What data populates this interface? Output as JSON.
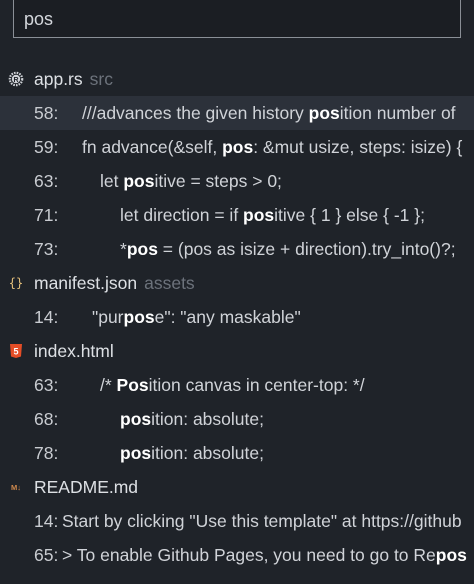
{
  "search": {
    "value": "pos"
  },
  "results": [
    {
      "kind": "file",
      "name": "app.rs",
      "dir": "src",
      "icon": "rust-icon"
    },
    {
      "kind": "line",
      "line": "58:",
      "pre": "///advances the given history ",
      "match": "pos",
      "post": "ition number of",
      "indent": 82,
      "selected": true
    },
    {
      "kind": "line",
      "line": "59:",
      "pre": "fn advance(&self, ",
      "match": "pos",
      "post": ": &mut usize, steps: isize) {",
      "indent": 82
    },
    {
      "kind": "line",
      "line": "63:",
      "pre": "let ",
      "match": "pos",
      "post": "itive = steps > 0;",
      "indent": 100
    },
    {
      "kind": "line",
      "line": "71:",
      "pre": "let direction = if ",
      "match": "pos",
      "post": "itive { 1 } else { -1 };",
      "indent": 120
    },
    {
      "kind": "line",
      "line": "73:",
      "pre": "*",
      "match": "pos",
      "post": " = (pos as isize + direction).try_into()?;",
      "indent": 120
    },
    {
      "kind": "file",
      "name": "manifest.json",
      "dir": "assets",
      "icon": "json-icon"
    },
    {
      "kind": "line",
      "line": "14:",
      "pre": "\"pur",
      "match": "pos",
      "post": "e\": \"any maskable\"",
      "indent": 92
    },
    {
      "kind": "file",
      "name": "index.html",
      "dir": "",
      "icon": "html5-icon"
    },
    {
      "kind": "line",
      "line": "63:",
      "pre": "/* ",
      "match": "Pos",
      "post": "ition canvas in center-top: */",
      "indent": 100
    },
    {
      "kind": "line",
      "line": "68:",
      "pre": "",
      "match": "pos",
      "post": "ition: absolute;",
      "indent": 120
    },
    {
      "kind": "line",
      "line": "78:",
      "pre": "",
      "match": "pos",
      "post": "ition: absolute;",
      "indent": 120
    },
    {
      "kind": "file",
      "name": "README.md",
      "dir": "",
      "icon": "markdown-icon"
    },
    {
      "kind": "line",
      "line": "14:",
      "pre": "Start by clicking \"Use this template\" at https://github",
      "match": "",
      "post": "",
      "indent": 62,
      "numLeft": 34
    },
    {
      "kind": "line",
      "line": "65:",
      "pre": "> To enable Github Pages, you need to go to Re",
      "match": "pos",
      "post": "",
      "indent": 62,
      "numLeft": 34
    }
  ],
  "colors": {
    "background": "#1f2329",
    "selected_row": "#2c313a",
    "match_text": "#ffffff",
    "dir_text": "#6c727b",
    "json_icon": "#e5c07b",
    "html_icon": "#e44d26",
    "md_icon": "#d08a4d",
    "rust_icon": "#d0d3d8"
  }
}
